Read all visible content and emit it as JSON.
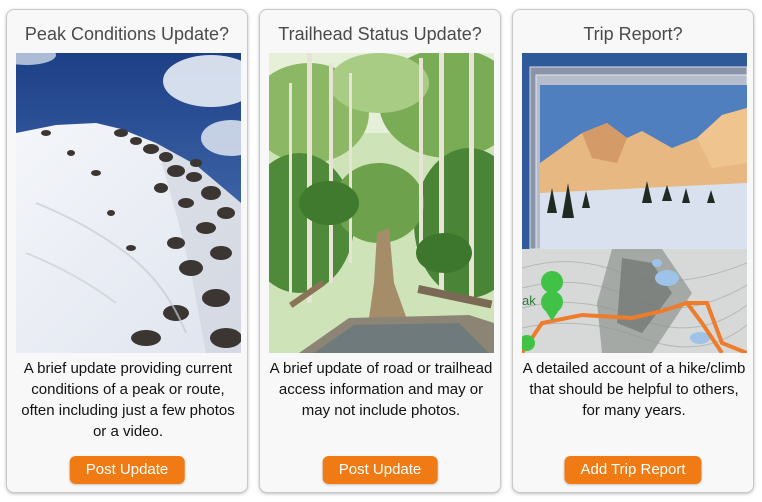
{
  "cards": [
    {
      "title": "Peak Conditions Update?",
      "description": "A brief update providing current conditions of a peak or route, often including just a few photos or a video.",
      "button_label": "Post Update",
      "image": "snowy-rocky-peak-photo"
    },
    {
      "title": "Trailhead Status Update?",
      "description": "A brief update of road or trailhead access information and may or may not include photos.",
      "button_label": "Post Update",
      "image": "aspen-trail-creek-crossing-photo"
    },
    {
      "title": "Trip Report?",
      "description": "A detailed account of a hike/climb that should be helpful to others, for many years.",
      "button_label": "Add Trip Report",
      "image": "mountain-photo-stack-and-topo-map",
      "map_label_fragment": "ak"
    }
  ],
  "colors": {
    "button_bg": "#f07b14",
    "button_text": "#ffffff",
    "title_text": "#4a4a4a",
    "card_bg": "#f8f8f8"
  }
}
